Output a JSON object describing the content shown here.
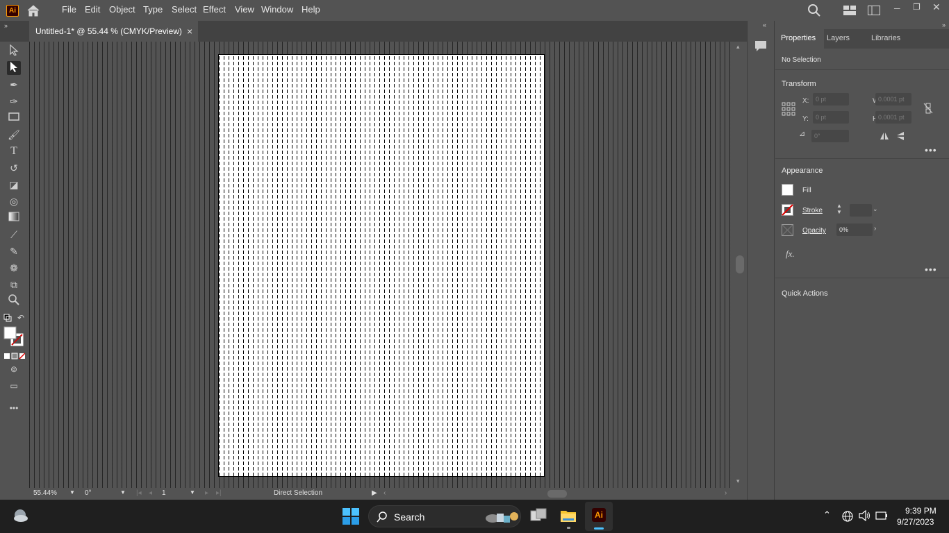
{
  "app": {
    "logo": "Ai"
  },
  "menu": [
    "File",
    "Edit",
    "Object",
    "Type",
    "Select",
    "Effect",
    "View",
    "Window",
    "Help"
  ],
  "document": {
    "tab_title": "Untitled-1* @ 55.44 % (CMYK/Preview)",
    "close": "×"
  },
  "status": {
    "zoom": "55.44%",
    "rotation": "0°",
    "artboard": "1",
    "tool": "Direct Selection"
  },
  "panel": {
    "tabs": [
      "Properties",
      "Layers",
      "Libraries"
    ],
    "selection": "No Selection",
    "transform": {
      "title": "Transform",
      "x_label": "X:",
      "x_value": "0 pt",
      "y_label": "Y:",
      "y_value": "0 pt",
      "w_label": "W:",
      "w_value": "0.0001 pt",
      "h_label": "H:",
      "h_value": "0.0001 pt",
      "angle_value": "0°"
    },
    "appearance": {
      "title": "Appearance",
      "fill_label": "Fill",
      "stroke_label": "Stroke",
      "opacity_label": "Opacity",
      "opacity_value": "0%",
      "fx": "fx."
    },
    "quick_actions": {
      "title": "Quick Actions"
    },
    "more": "•••"
  },
  "taskbar": {
    "search": "Search",
    "time": "9:39 PM",
    "date": "9/27/2023",
    "ai_label": "Ai"
  }
}
